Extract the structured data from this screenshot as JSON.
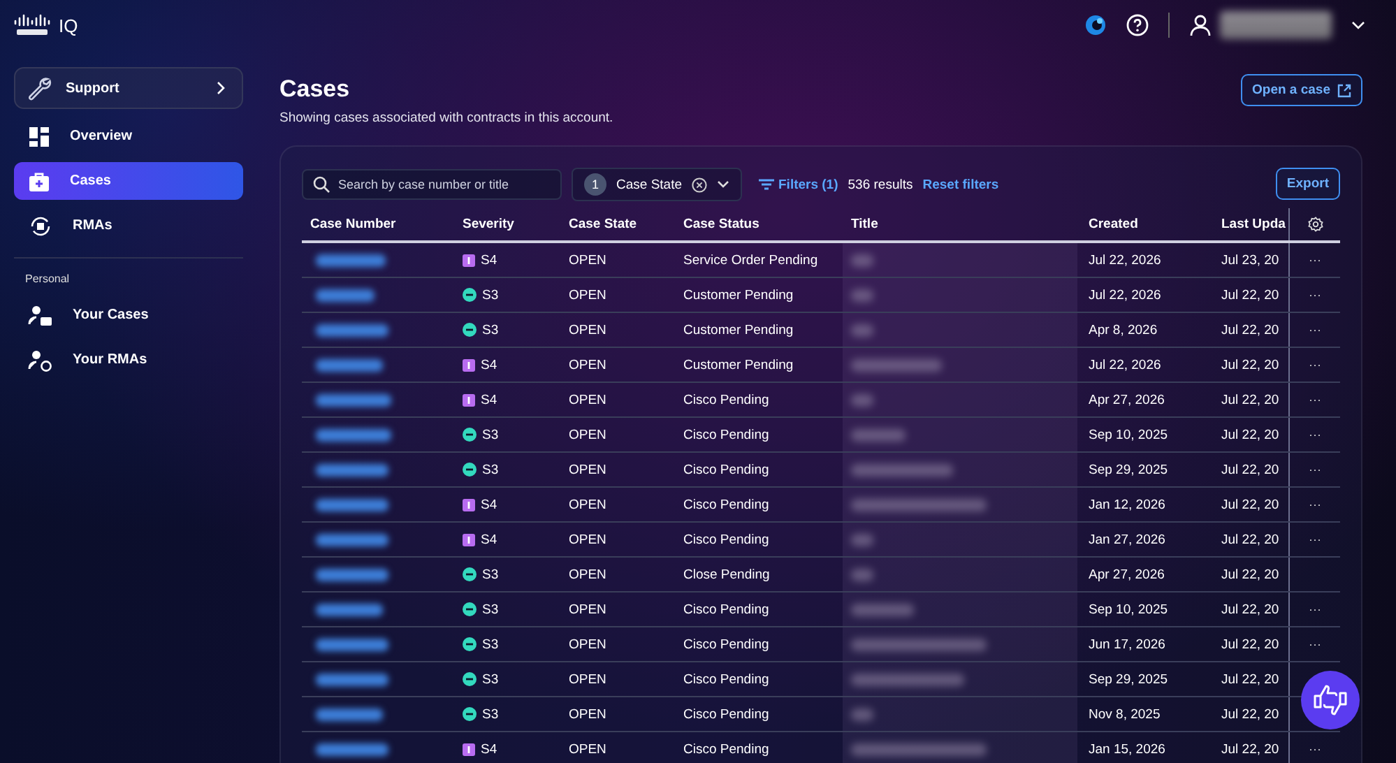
{
  "brand": {
    "product": "IQ"
  },
  "nav": {
    "support": "Support",
    "items": [
      {
        "label": "Overview",
        "selected": false
      },
      {
        "label": "Cases",
        "selected": true
      },
      {
        "label": "RMAs",
        "selected": false
      }
    ],
    "section": "Personal",
    "personal": [
      {
        "label": "Your Cases"
      },
      {
        "label": "Your RMAs"
      }
    ]
  },
  "page": {
    "title": "Cases",
    "subtitle": "Showing cases associated with contracts in this account.",
    "open_case": "Open a case"
  },
  "toolbar": {
    "search_placeholder": "Search by case number or title",
    "filter_count": "1",
    "filter_label": "Case State",
    "filters": "Filters (1)",
    "results": "536 results",
    "reset": "Reset filters",
    "export": "Export"
  },
  "table": {
    "columns": [
      "Case Number",
      "Severity",
      "Case State",
      "Case Status",
      "Title",
      "Created",
      "Last Upda"
    ],
    "rows": [
      {
        "severity": "S4",
        "kind": "s4",
        "state": "OPEN",
        "status": "Service Order Pending",
        "created": "Jul 22, 2026",
        "updated": "Jul 23, 20",
        "actions": "···"
      },
      {
        "severity": "S3",
        "kind": "s3",
        "state": "OPEN",
        "status": "Customer Pending",
        "created": "Jul 22, 2026",
        "updated": "Jul 22, 20",
        "actions": "···"
      },
      {
        "severity": "S3",
        "kind": "s3",
        "state": "OPEN",
        "status": "Customer Pending",
        "created": "Apr 8, 2026",
        "updated": "Jul 22, 20",
        "actions": "···"
      },
      {
        "severity": "S4",
        "kind": "s4",
        "state": "OPEN",
        "status": "Customer Pending",
        "created": "Jul 22, 2026",
        "updated": "Jul 22, 20",
        "actions": "···"
      },
      {
        "severity": "S4",
        "kind": "s4",
        "state": "OPEN",
        "status": "Cisco Pending",
        "created": "Apr 27, 2026",
        "updated": "Jul 22, 20",
        "actions": "···"
      },
      {
        "severity": "S3",
        "kind": "s3",
        "state": "OPEN",
        "status": "Cisco Pending",
        "created": "Sep 10, 2025",
        "updated": "Jul 22, 20",
        "actions": "···"
      },
      {
        "severity": "S3",
        "kind": "s3",
        "state": "OPEN",
        "status": "Cisco Pending",
        "created": "Sep 29, 2025",
        "updated": "Jul 22, 20",
        "actions": "···"
      },
      {
        "severity": "S4",
        "kind": "s4",
        "state": "OPEN",
        "status": "Cisco Pending",
        "created": "Jan 12, 2026",
        "updated": "Jul 22, 20",
        "actions": "···"
      },
      {
        "severity": "S4",
        "kind": "s4",
        "state": "OPEN",
        "status": "Cisco Pending",
        "created": "Jan 27, 2026",
        "updated": "Jul 22, 20",
        "actions": "···"
      },
      {
        "severity": "S3",
        "kind": "s3",
        "state": "OPEN",
        "status": "Close Pending",
        "created": "Apr 27, 2026",
        "updated": "Jul 22, 20"
      },
      {
        "severity": "S3",
        "kind": "s3",
        "state": "OPEN",
        "status": "Cisco Pending",
        "created": "Sep 10, 2025",
        "updated": "Jul 22, 20",
        "actions": "···"
      },
      {
        "severity": "S3",
        "kind": "s3",
        "state": "OPEN",
        "status": "Cisco Pending",
        "created": "Jun 17, 2026",
        "updated": "Jul 22, 20",
        "actions": "···"
      },
      {
        "severity": "S3",
        "kind": "s3",
        "state": "OPEN",
        "status": "Cisco Pending",
        "created": "Sep 29, 2025",
        "updated": "Jul 22, 20"
      },
      {
        "severity": "S3",
        "kind": "s3",
        "state": "OPEN",
        "status": "Cisco Pending",
        "created": "Nov 8, 2025",
        "updated": "Jul 22, 20"
      },
      {
        "severity": "S4",
        "kind": "s4",
        "state": "OPEN",
        "status": "Cisco Pending",
        "created": "Jan 15, 2026",
        "updated": "Jul 22, 20",
        "actions": "···"
      }
    ]
  }
}
